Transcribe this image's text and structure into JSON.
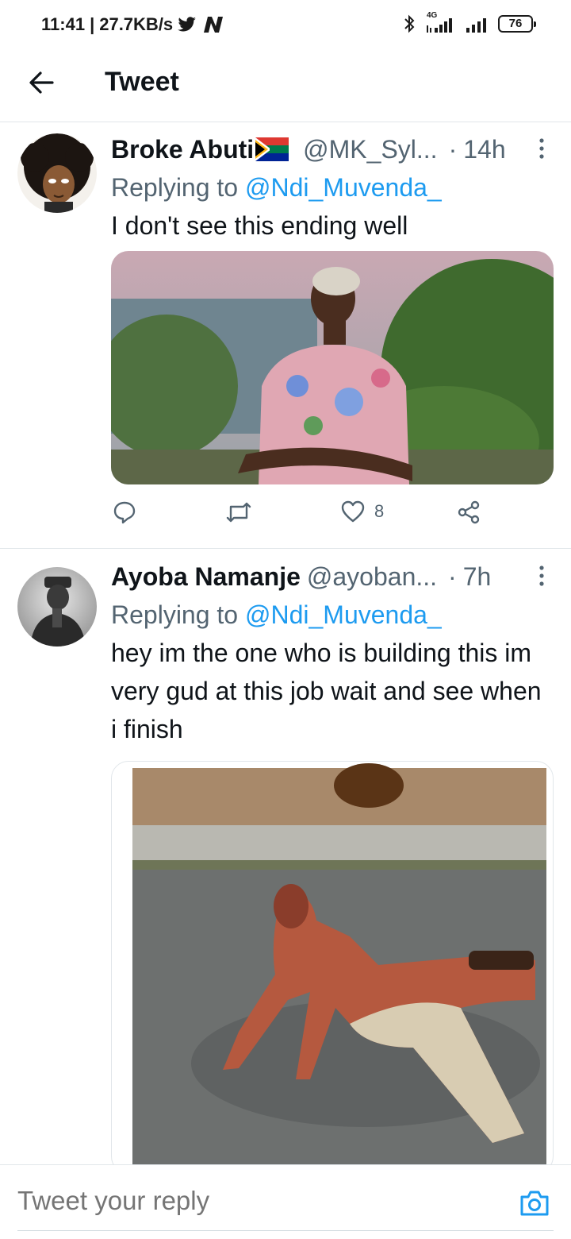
{
  "status_bar": {
    "time": "11:41",
    "speed": "27.7KB/s",
    "network": "4G",
    "battery": "76"
  },
  "header": {
    "title": "Tweet"
  },
  "tweets": [
    {
      "name": "Broke Abuti",
      "handle": "@MK_Syl...",
      "time": "14h",
      "replying_prefix": "Replying to",
      "replying_to": "@Ndi_Muvenda_",
      "text": "I don't see this ending well",
      "like_count": "8"
    },
    {
      "name": "Ayoba Namanje",
      "handle": "@ayoban...",
      "time": "7h",
      "replying_prefix": "Replying to",
      "replying_to": "@Ndi_Muvenda_",
      "text": "hey im the one who is building this im very gud at this job wait and see when i finish"
    }
  ],
  "reply_bar": {
    "placeholder": "Tweet your reply"
  },
  "colors": {
    "link": "#1d9bf0",
    "secondary": "#536471",
    "primary_text": "#0f1419"
  }
}
